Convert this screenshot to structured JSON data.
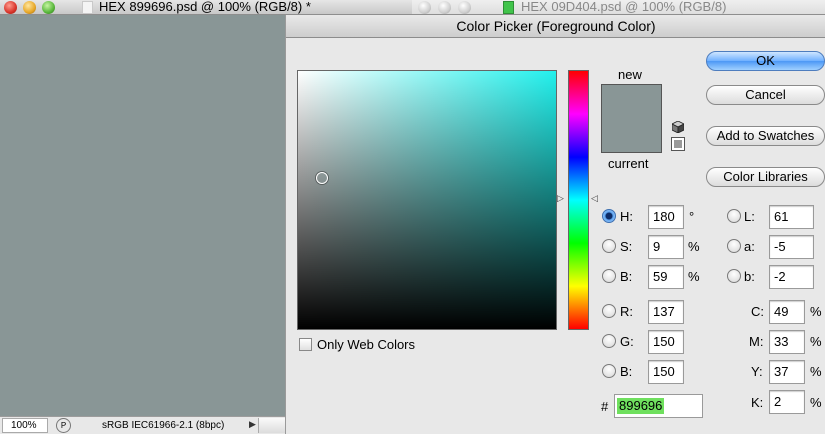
{
  "doc1": {
    "title": "HEX 899696.psd @ 100% (RGB/8) *"
  },
  "doc2": {
    "title": "HEX 09D404.psd @ 100% (RGB/8)"
  },
  "status": {
    "zoom": "100%",
    "profile": "sRGB IEC61966-2.1 (8bpc)"
  },
  "dialog": {
    "title": "Color Picker (Foreground Color)"
  },
  "labels": {
    "new": "new",
    "current": "current",
    "only_web": "Only Web Colors",
    "hash": "#"
  },
  "buttons": {
    "ok": "OK",
    "cancel": "Cancel",
    "add": "Add to Swatches",
    "libraries": "Color Libraries"
  },
  "hsb": {
    "h": {
      "label": "H:",
      "value": "180",
      "unit": "°"
    },
    "s": {
      "label": "S:",
      "value": "9",
      "unit": "%"
    },
    "b": {
      "label": "B:",
      "value": "59",
      "unit": "%"
    }
  },
  "rgb": {
    "r": {
      "label": "R:",
      "value": "137"
    },
    "g": {
      "label": "G:",
      "value": "150"
    },
    "b": {
      "label": "B:",
      "value": "150"
    }
  },
  "lab": {
    "l": {
      "label": "L:",
      "value": "61"
    },
    "a": {
      "label": "a:",
      "value": "-5"
    },
    "b": {
      "label": "b:",
      "value": "-2"
    }
  },
  "cmyk": {
    "c": {
      "label": "C:",
      "value": "49",
      "unit": "%"
    },
    "m": {
      "label": "M:",
      "value": "33",
      "unit": "%"
    },
    "y": {
      "label": "Y:",
      "value": "37",
      "unit": "%"
    },
    "k": {
      "label": "K:",
      "value": "2",
      "unit": "%"
    }
  },
  "hex": "899696",
  "colors": {
    "new_swatch": "#899696",
    "current_swatch": "#899696",
    "hex_highlight": "#6fe05e"
  },
  "icons": {
    "gamut": "cube-icon",
    "websafe": "websafe-icon"
  }
}
